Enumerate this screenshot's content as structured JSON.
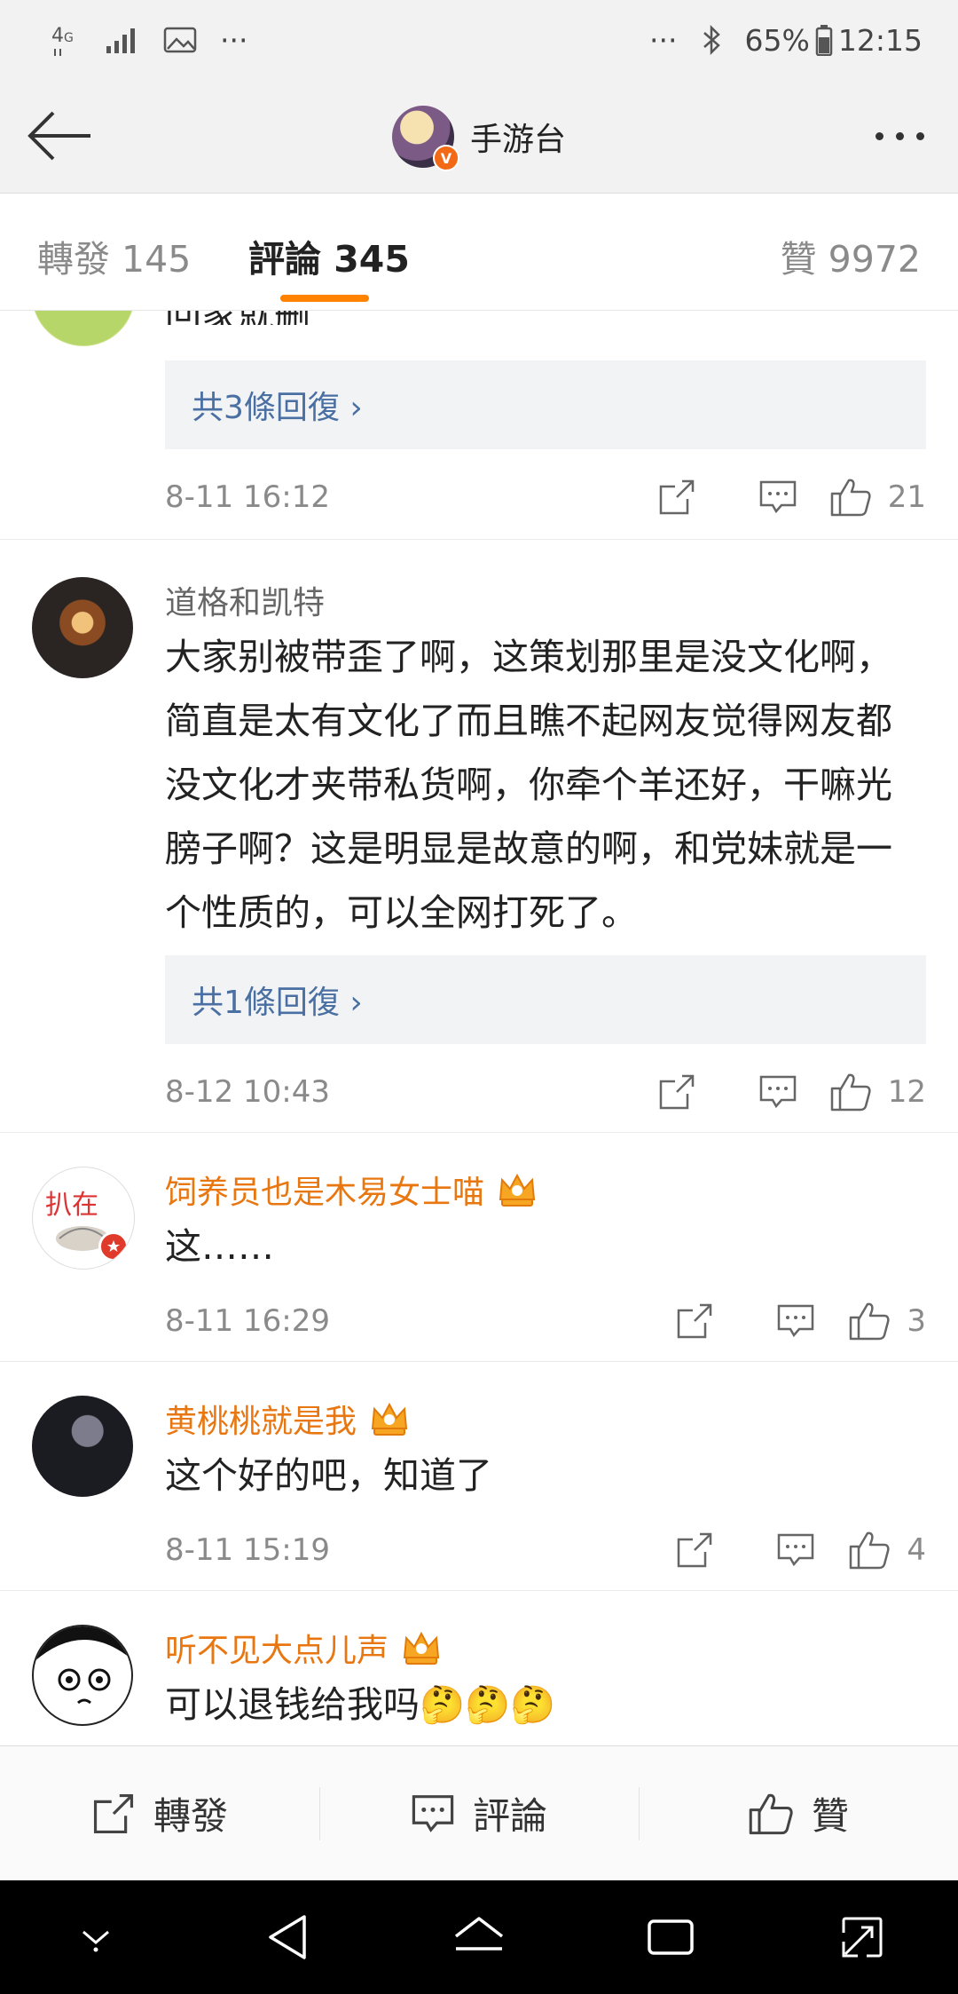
{
  "status_bar": {
    "network": "4G",
    "dots": "···",
    "battery": "65%",
    "time": "12:15"
  },
  "header": {
    "title": "手游台",
    "badge": "V"
  },
  "tabs": [
    {
      "label": "轉發 145",
      "active": false
    },
    {
      "label": "評論 345",
      "active": true
    },
    {
      "label": "贊 9972",
      "active": false
    }
  ],
  "comments": [
    {
      "username": "",
      "text": "回家就删",
      "replies": "共3條回復 ›",
      "time": "8-11 16:12",
      "likes": "21"
    },
    {
      "username": "道格和凯特",
      "text": "大家别被带歪了啊，这策划那里是没文化啊，简直是太有文化了而且瞧不起网友觉得网友都没文化才夹带私货啊，你牵个羊还好，干嘛光膀子啊？这是明显是故意的啊，和党妹就是一个性质的，可以全网打死了。",
      "replies": "共1條回復 ›",
      "time": "8-12 10:43",
      "likes": "12"
    },
    {
      "username": "饲养员也是木易女士喵",
      "avatar_text": "扒在",
      "text": "这……",
      "time": "8-11 16:29",
      "likes": "3"
    },
    {
      "username": "黄桃桃就是我",
      "text": "这个好的吧，知道了",
      "time": "8-11 15:19",
      "likes": "4"
    },
    {
      "username": "听不见大点儿声",
      "text": "可以退钱给我吗🤔🤔🤔",
      "time": "",
      "likes": ""
    }
  ],
  "action_bar": {
    "repost": "轉發",
    "comment": "評論",
    "like": "贊"
  },
  "colors": {
    "accent": "#ff8200",
    "vip_name": "#e97711",
    "reply_link": "#4a6fa2"
  }
}
